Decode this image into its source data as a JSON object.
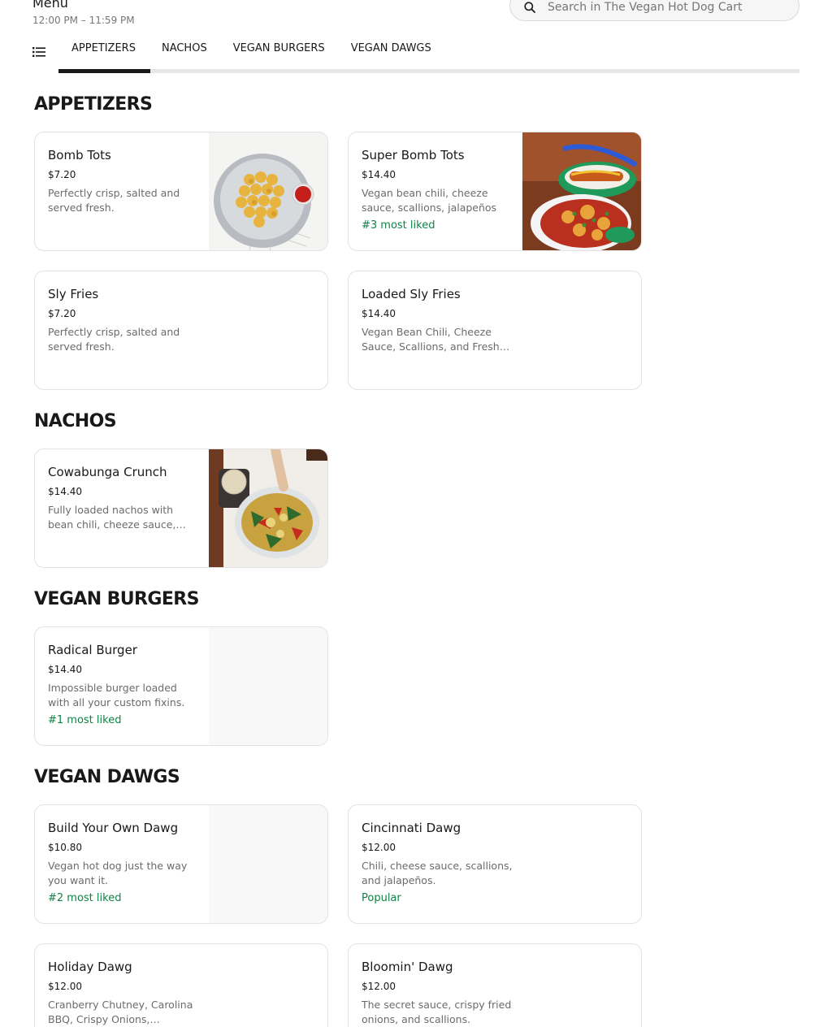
{
  "header": {
    "title": "Menu",
    "hours": "12:00 PM – 11:59 PM",
    "search_placeholder": "Search in The Vegan Hot Dog Cart"
  },
  "tabs": [
    {
      "label": "APPETIZERS",
      "active": true
    },
    {
      "label": "NACHOS",
      "active": false
    },
    {
      "label": "VEGAN BURGERS",
      "active": false
    },
    {
      "label": "VEGAN DAWGS",
      "active": false
    }
  ],
  "sections": {
    "appetizers": {
      "title": "APPETIZERS",
      "items": [
        {
          "name": "Bomb Tots",
          "price": "$7.20",
          "description": "Perfectly crisp, salted and served fresh.",
          "badge": "",
          "image": "tots-photo"
        },
        {
          "name": "Super Bomb Tots",
          "price": "$14.40",
          "description": "Vegan bean chili, cheeze sauce, scallions, jalapeños",
          "badge": "#3 most liked",
          "image": "loaded-tots-photo"
        },
        {
          "name": "Sly Fries",
          "price": "$7.20",
          "description": "Perfectly crisp, salted and served fresh.",
          "badge": "",
          "image": ""
        },
        {
          "name": "Loaded Sly Fries",
          "price": "$14.40",
          "description": "Vegan Bean Chili, Cheeze Sauce, Scallions, and Fresh…",
          "badge": "",
          "image": ""
        }
      ]
    },
    "nachos": {
      "title": "NACHOS",
      "items": [
        {
          "name": "Cowabunga Crunch",
          "price": "$14.40",
          "description": "Fully loaded nachos with bean chili, cheeze sauce,…",
          "badge": "",
          "image": "nachos-photo"
        }
      ]
    },
    "burgers": {
      "title": "VEGAN BURGERS",
      "items": [
        {
          "name": "Radical Burger",
          "price": "$14.40",
          "description": "Impossible burger loaded with all your custom fixins.",
          "badge": "#1 most liked",
          "image": "placeholder"
        }
      ]
    },
    "dawgs": {
      "title": "VEGAN DAWGS",
      "items": [
        {
          "name": "Build Your Own Dawg",
          "price": "$10.80",
          "description": "Vegan hot dog just the way you want it.",
          "badge": "#2 most liked",
          "image": "placeholder"
        },
        {
          "name": "Cincinnati Dawg",
          "price": "$12.00",
          "description": "Chili, cheese sauce, scallions, and jalapeños.",
          "badge": "Popular",
          "image": ""
        },
        {
          "name": "Holiday Dawg",
          "price": "$12.00",
          "description": "Cranberry Chutney, Carolina BBQ, Crispy Onions,…",
          "badge": "",
          "image": ""
        },
        {
          "name": "Bloomin' Dawg",
          "price": "$12.00",
          "description": "The secret sauce, crispy fried onions, and scallions.",
          "badge": "",
          "image": ""
        }
      ]
    }
  },
  "colors": {
    "text": "#191919",
    "muted": "#6b6b6b",
    "badge_green": "#0e8345",
    "border": "#e2e2e2",
    "tab_track": "#e7e7ea"
  }
}
